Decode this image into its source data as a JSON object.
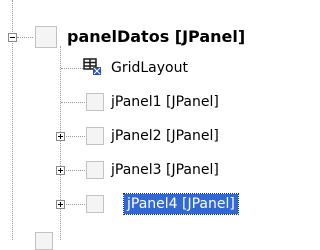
{
  "tree": {
    "root": {
      "label": "panelDatos [JPanel]",
      "expanded": true
    },
    "children": [
      {
        "label": "GridLayout",
        "icon": "grid-layout-icon",
        "expandable": false
      },
      {
        "label": "jPanel1 [JPanel]",
        "icon": "panel-icon",
        "expandable": false
      },
      {
        "label": "jPanel2 [JPanel]",
        "icon": "panel-icon",
        "expandable": true
      },
      {
        "label": "jPanel3 [JPanel]",
        "icon": "panel-icon",
        "expandable": true
      },
      {
        "label": "jPanel4 [JPanel]",
        "icon": "panel-icon",
        "expandable": true,
        "selected": true
      }
    ]
  },
  "colors": {
    "selection": "#3168d5",
    "tree_line": "#9a9a9a"
  }
}
